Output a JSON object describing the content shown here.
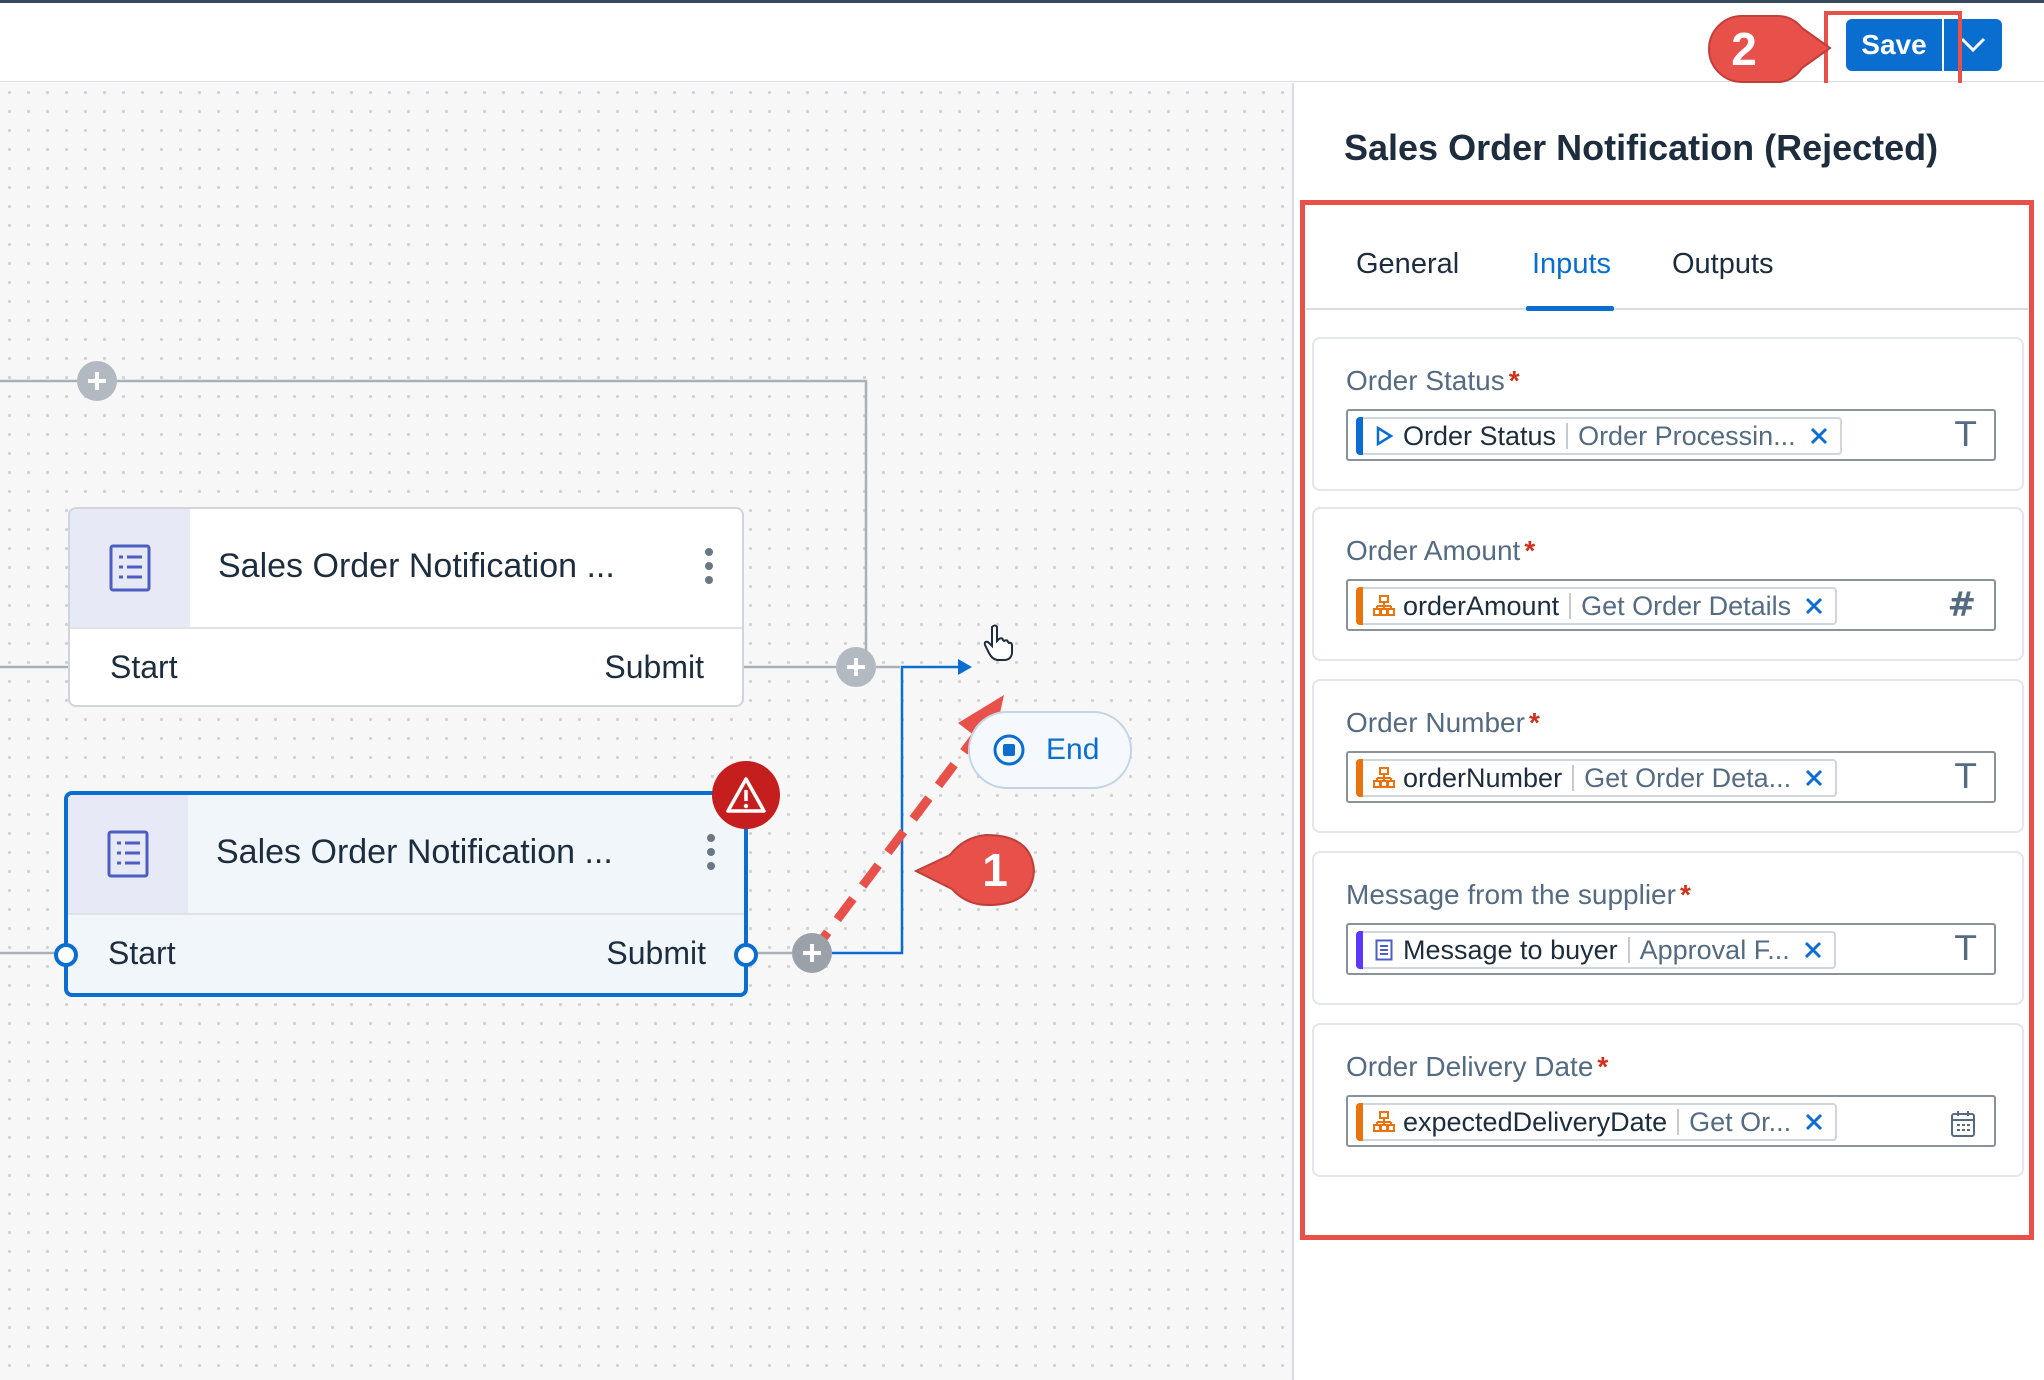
{
  "toolbar": {
    "save_label": "Save",
    "save_menu_icon": "chevron-down-icon"
  },
  "callouts": [
    {
      "number": "1",
      "color": "#e8504a"
    },
    {
      "number": "2",
      "color": "#e8504a"
    }
  ],
  "canvas": {
    "nodes": [
      {
        "title": "Sales Order Notification ...",
        "start_label": "Start",
        "submit_label": "Submit",
        "icon": "form-icon",
        "selected": false
      },
      {
        "title": "Sales Order Notification ...",
        "start_label": "Start",
        "submit_label": "Submit",
        "icon": "form-icon",
        "selected": true,
        "status": "warning"
      }
    ],
    "end_node": {
      "label": "End",
      "icon": "stop-circle-icon"
    }
  },
  "panel": {
    "title": "Sales Order Notification (Rejected)",
    "tabs": [
      {
        "label": "General",
        "active": false
      },
      {
        "label": "Inputs",
        "active": true
      },
      {
        "label": "Outputs",
        "active": false
      }
    ],
    "fields": [
      {
        "label": "Order Status",
        "required": "*",
        "token_name": "Order Status",
        "token_source": "Order Processin...",
        "token_icon": "trigger-icon",
        "token_color": "#0a6ed1",
        "type_icon": "T"
      },
      {
        "label": "Order Amount",
        "required": "*",
        "token_name": "orderAmount",
        "token_source": "Get Order Details",
        "token_icon": "hierarchy-icon",
        "token_color": "#e9730c",
        "type_icon": "#"
      },
      {
        "label": "Order Number",
        "required": "*",
        "token_name": "orderNumber",
        "token_source": "Get Order Deta...",
        "token_icon": "hierarchy-icon",
        "token_color": "#e9730c",
        "type_icon": "T"
      },
      {
        "label": "Message from the supplier",
        "required": "*",
        "token_name": "Message to buyer",
        "token_source": "Approval F...",
        "token_icon": "form-icon",
        "token_color": "#5d36ff",
        "type_icon": "T"
      },
      {
        "label": "Order Delivery Date",
        "required": "*",
        "token_name": "expectedDeliveryDate",
        "token_source": "Get Or...",
        "token_icon": "hierarchy-icon",
        "token_color": "#e9730c",
        "type_icon": "calendar-icon"
      }
    ]
  },
  "colors": {
    "accent": "#0a6ed1",
    "highlight": "#e8504a",
    "error": "#c51e1e"
  }
}
